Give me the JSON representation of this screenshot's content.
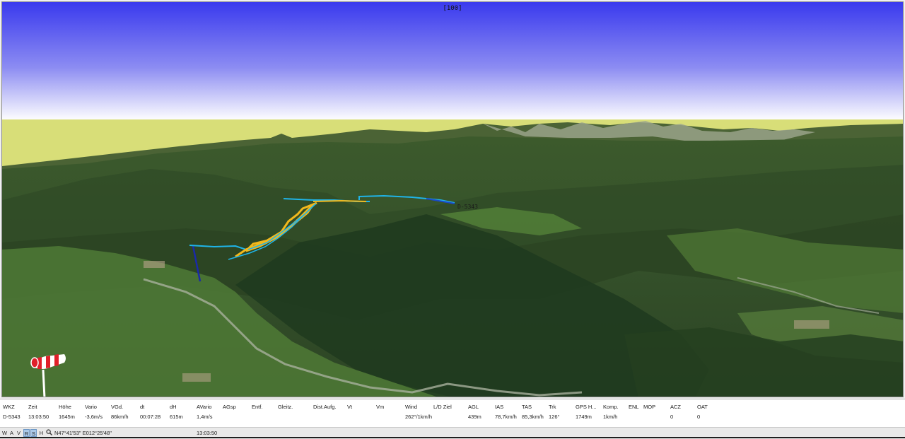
{
  "viewport": {
    "zoom_label": "[100]",
    "glider_label": "D-5343"
  },
  "colors": {
    "sky_top": "#3a3aee",
    "sky_bottom": "#ffffff",
    "horizon_band": "#d8de78",
    "track_yellow": "#f2b81c",
    "track_cyan": "#1fb4e8",
    "track_blue": "#1a2aa8"
  },
  "status": {
    "headers": [
      "WKZ",
      "Zeit",
      "Höhe",
      "Vario",
      "VGd.",
      "dt",
      "dH",
      "AVario",
      "AGsp",
      "Entf.",
      "Gleitz.",
      "Dist.Aufg.",
      "Vt",
      "Vm",
      "Wind",
      "L/D Ziel",
      "AGL",
      "IAS",
      "TAS",
      "Trk",
      "GPS H...",
      "Komp.",
      "ENL",
      "MOP",
      "ACZ",
      "OAT"
    ],
    "values": [
      "D-5343",
      "13:03:50",
      "1645m",
      "-3,6m/s",
      "86km/h",
      "00:07:28",
      "615m",
      "1,4m/s",
      "",
      "",
      "",
      "",
      "",
      "",
      "262°/1km/h",
      "",
      "439m",
      "78,7km/h",
      "85,3km/h",
      "126°",
      "1749m",
      "1km/h",
      "",
      "",
      "0",
      "0"
    ]
  },
  "toolbar": {
    "buttons": [
      "W",
      "A",
      "V",
      "R",
      "S",
      "H"
    ],
    "coords": "N47°41'53\" E012°25'48\"",
    "time": "13:03:50"
  }
}
